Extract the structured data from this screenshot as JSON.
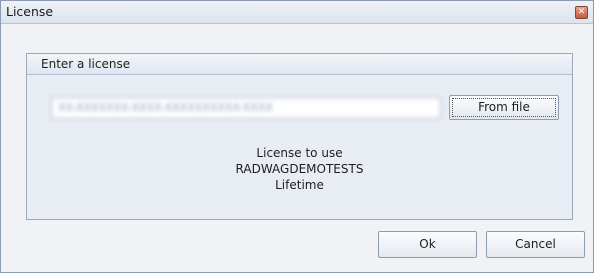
{
  "window": {
    "title": "License",
    "close_glyph": "✕"
  },
  "group": {
    "title": "Enter a license",
    "license_key": "XX-XXXXXXX-XXXX-XXXXXXXXXX-XXXX",
    "from_file_label": "From file",
    "info_line1": "License to use",
    "info_line2": "RADWAGDEMOTESTS",
    "info_line3": "Lifetime"
  },
  "footer": {
    "ok_label": "Ok",
    "cancel_label": "Cancel"
  }
}
